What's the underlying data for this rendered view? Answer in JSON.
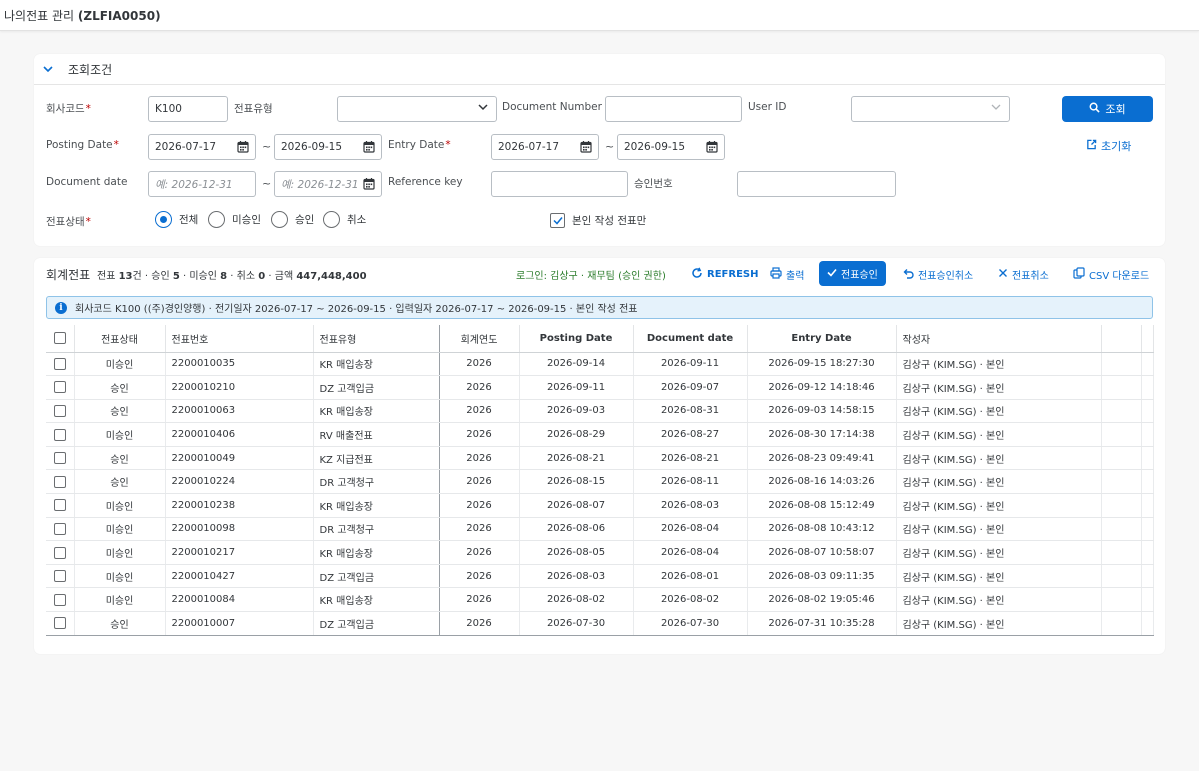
{
  "app": {
    "title_prefix": "나의전표 관리",
    "title_code": "(ZLFIA0050)"
  },
  "filter": {
    "section_title": "조회조건",
    "company_code_label": "회사코드",
    "company_code_value": "K100",
    "doc_type_label": "전표유형",
    "doc_type_value": "",
    "doc_number_label": "Document Number",
    "doc_number_value": "",
    "user_id_label": "User ID",
    "user_id_value": "",
    "search_button": "조회",
    "posting_date_label": "Posting Date",
    "posting_date_from": "2026-07-17",
    "posting_date_to": "2026-09-15",
    "entry_date_label": "Entry Date",
    "entry_date_from": "2026-07-17",
    "entry_date_to": "2026-09-15",
    "reset_button": "초기화",
    "document_date_label": "Document date",
    "document_date_from_placeholder": "예: 2026-12-31",
    "document_date_to_placeholder": "예: 2026-12-31",
    "reference_key_label": "Reference key",
    "reference_key_value": "",
    "approval_no_label": "승인번호",
    "approval_no_value": "",
    "status_label": "전표상태",
    "status_options": [
      "전체",
      "미승인",
      "승인",
      "취소"
    ],
    "status_selected": "전체",
    "own_only_label": "본인 작성 전표만",
    "own_only_checked": true,
    "tilde": "~"
  },
  "list": {
    "title": "회계전표",
    "summary_prefix": "전표",
    "total_count": "13",
    "summary_count_unit": "건 · 승인",
    "approved_count": "5",
    "summary_pending_label": " · 미승인",
    "pending_count": "8",
    "summary_cancel_label": " · 취소",
    "cancel_count": "0",
    "summary_amount_label": " · 금액",
    "amount": "447,448,400",
    "login_info": "로그인: 김상구 · 재무팀 (승인 권한)",
    "toolbar": {
      "refresh": "REFRESH",
      "print": "출력",
      "approve": "전표승인",
      "approve_cancel": "전표승인취소",
      "cancel_doc": "전표취소",
      "csv_download": "CSV 다운로드"
    },
    "info_text": "회사코드 K100 ((주)경인양행) · 전기일자 2026-07-17 ~ 2026-09-15 · 입력일자 2026-07-17 ~ 2026-09-15 · 본인 작성 전표",
    "columns": [
      "전표상태",
      "전표번호",
      "전표유형",
      "회계연도",
      "Posting Date",
      "Document date",
      "Entry Date",
      "작성자"
    ],
    "rows": [
      {
        "status": "미승인",
        "docno": "2200010035",
        "type": "KR 매입송장",
        "year": "2026",
        "posting": "2026-09-14",
        "docdate": "2026-09-11",
        "entry": "2026-09-15 18:27:30",
        "author": "김상구 (KIM.SG) · 본인"
      },
      {
        "status": "승인",
        "docno": "2200010210",
        "type": "DZ 고객입금",
        "year": "2026",
        "posting": "2026-09-11",
        "docdate": "2026-09-07",
        "entry": "2026-09-12 14:18:46",
        "author": "김상구 (KIM.SG) · 본인"
      },
      {
        "status": "승인",
        "docno": "2200010063",
        "type": "KR 매입송장",
        "year": "2026",
        "posting": "2026-09-03",
        "docdate": "2026-08-31",
        "entry": "2026-09-03 14:58:15",
        "author": "김상구 (KIM.SG) · 본인"
      },
      {
        "status": "미승인",
        "docno": "2200010406",
        "type": "RV 매출전표",
        "year": "2026",
        "posting": "2026-08-29",
        "docdate": "2026-08-27",
        "entry": "2026-08-30 17:14:38",
        "author": "김상구 (KIM.SG) · 본인"
      },
      {
        "status": "승인",
        "docno": "2200010049",
        "type": "KZ 지급전표",
        "year": "2026",
        "posting": "2026-08-21",
        "docdate": "2026-08-21",
        "entry": "2026-08-23 09:49:41",
        "author": "김상구 (KIM.SG) · 본인"
      },
      {
        "status": "승인",
        "docno": "2200010224",
        "type": "DR 고객청구",
        "year": "2026",
        "posting": "2026-08-15",
        "docdate": "2026-08-11",
        "entry": "2026-08-16 14:03:26",
        "author": "김상구 (KIM.SG) · 본인"
      },
      {
        "status": "미승인",
        "docno": "2200010238",
        "type": "KR 매입송장",
        "year": "2026",
        "posting": "2026-08-07",
        "docdate": "2026-08-03",
        "entry": "2026-08-08 15:12:49",
        "author": "김상구 (KIM.SG) · 본인"
      },
      {
        "status": "미승인",
        "docno": "2200010098",
        "type": "DR 고객청구",
        "year": "2026",
        "posting": "2026-08-06",
        "docdate": "2026-08-04",
        "entry": "2026-08-08 10:43:12",
        "author": "김상구 (KIM.SG) · 본인"
      },
      {
        "status": "미승인",
        "docno": "2200010217",
        "type": "KR 매입송장",
        "year": "2026",
        "posting": "2026-08-05",
        "docdate": "2026-08-04",
        "entry": "2026-08-07 10:58:07",
        "author": "김상구 (KIM.SG) · 본인"
      },
      {
        "status": "미승인",
        "docno": "2200010427",
        "type": "DZ 고객입금",
        "year": "2026",
        "posting": "2026-08-03",
        "docdate": "2026-08-01",
        "entry": "2026-08-03 09:11:35",
        "author": "김상구 (KIM.SG) · 본인"
      },
      {
        "status": "미승인",
        "docno": "2200010084",
        "type": "KR 매입송장",
        "year": "2026",
        "posting": "2026-08-02",
        "docdate": "2026-08-02",
        "entry": "2026-08-02 19:05:46",
        "author": "김상구 (KIM.SG) · 본인"
      },
      {
        "status": "승인",
        "docno": "2200010007",
        "type": "DZ 고객입금",
        "year": "2026",
        "posting": "2026-07-30",
        "docdate": "2026-07-30",
        "entry": "2026-07-31 10:35:28",
        "author": "김상구 (KIM.SG) · 본인"
      }
    ]
  },
  "colors": {
    "accent": "#0a6ed1",
    "pending": "#c35500",
    "approved": "#2b7c2b",
    "required": "#bb0000"
  },
  "icons": {
    "collapse": "chevron-down-icon",
    "date": "calendar-icon",
    "dropdown": "chevron-down-icon",
    "search": "search-icon",
    "reset": "reset-icon",
    "refresh": "refresh-icon",
    "print": "printer-icon",
    "approve": "check-icon",
    "undo": "undo-icon",
    "cancel": "close-icon",
    "csv": "copy-icon",
    "info": "info-icon"
  }
}
